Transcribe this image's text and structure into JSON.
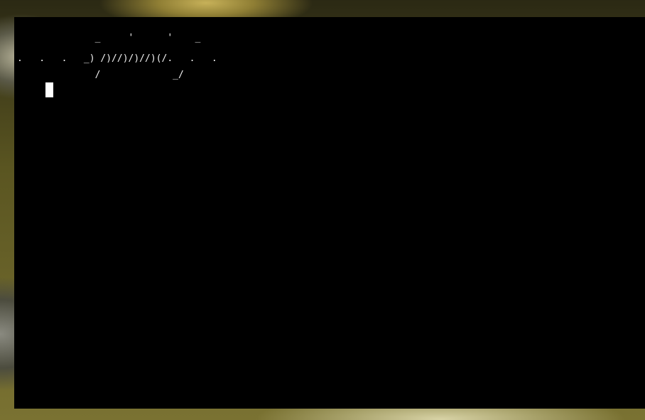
{
  "terminal": {
    "lines": [
      "              _     '      '    _",
      ".   .   .   _) /)//)/)//)(/.   .   .",
      "              /             _/"
    ],
    "cursor": "block"
  },
  "colors": {
    "terminal_background": "#000000",
    "terminal_foreground": "#f2f2f2",
    "wallpaper_accent": "#8f7e34"
  }
}
